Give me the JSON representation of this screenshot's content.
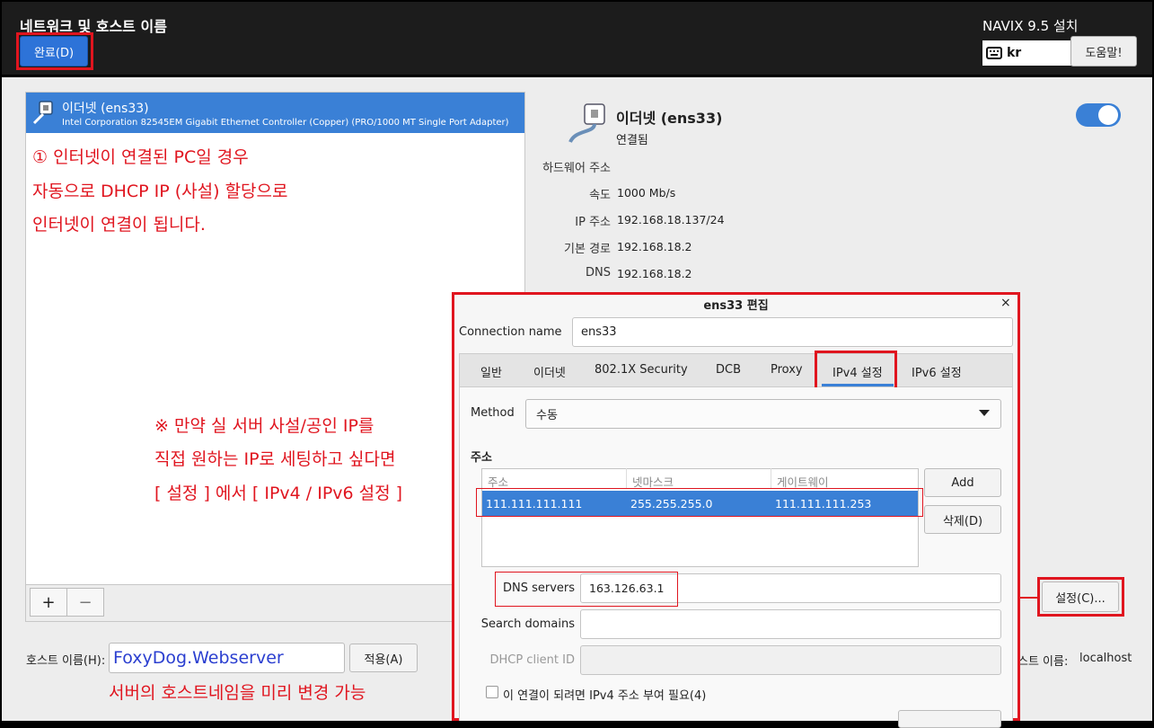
{
  "header": {
    "title": "네트워크 및 호스트 이름",
    "done_label": "완료(D)",
    "app_title": "NAVIX 9.5 설치",
    "keyboard_layout": "kr",
    "help_label": "도움말!"
  },
  "network_list": {
    "items": [
      {
        "name": "이더넷 (ens33)",
        "description": "Intel Corporation 82545EM Gigabit Ethernet Controller (Copper) (PRO/1000 MT Single Port Adapter)"
      }
    ],
    "add_label": "+",
    "remove_label": "−"
  },
  "annotations": {
    "a1_line1": "① 인터넷이 연결된 PC일 경우",
    "a1_line2": "자동으로 DHCP IP (사설) 할당으로",
    "a1_line3": "인터넷이 연결이 됩니다.",
    "a2_line1": "※ 만약 실 서버 사설/공인 IP를",
    "a2_line2": "직접 원하는 IP로 세팅하고 싶다면",
    "a2_line3": "[ 설정 ] 에서 [ IPv4 / IPv6 설정 ]",
    "a3": "서버의 호스트네임을 미리 변경 가능"
  },
  "hostname": {
    "label": "호스트 이름(H):",
    "value": "FoxyDog.Webserver",
    "apply_label": "적용(A)",
    "current_label": "스트 이름:",
    "current_value": "localhost"
  },
  "details": {
    "name": "이더넷 (ens33)",
    "status": "연결됨",
    "connected": true,
    "rows": [
      {
        "key": "하드웨어 주소",
        "value": ""
      },
      {
        "key": "속도",
        "value": "1000 Mb/s"
      },
      {
        "key": "IP 주소",
        "value": "192.168.18.137/24"
      },
      {
        "key": "기본 경로",
        "value": "192.168.18.2"
      },
      {
        "key": "DNS",
        "value": "192.168.18.2"
      }
    ],
    "settings_label": "설정(C)..."
  },
  "dialog": {
    "title": "ens33 편집",
    "close": "×",
    "connection_name_label": "Connection name",
    "connection_name": "ens33",
    "tabs": [
      "일반",
      "이더넷",
      "802.1X Security",
      "DCB",
      "Proxy",
      "IPv4 설정",
      "IPv6 설정"
    ],
    "active_tab": "IPv4 설정",
    "method_label": "Method",
    "method_value": "수동",
    "address_section": "주소",
    "columns": [
      "주소",
      "넷마스크",
      "게이트웨이"
    ],
    "rows": [
      {
        "address": "111.111.111.111",
        "netmask": "255.255.255.0",
        "gateway": "111.111.111.253"
      }
    ],
    "add_label": "Add",
    "delete_label": "삭제(D)",
    "dns_label": "DNS servers",
    "dns_value": "163.126.63.1",
    "search_label": "Search domains",
    "search_value": "",
    "dhcp_label": "DHCP client ID",
    "dhcp_value": "",
    "require_ipv4_label": "이 연결이 되려면 IPv4 주소 부여 필요(4)",
    "require_ipv4_checked": false
  },
  "colors": {
    "accent": "#3a80d6",
    "annotation": "#e0151f",
    "header_bg": "#1c1c1c",
    "hostname_text": "#2b3fd0"
  }
}
